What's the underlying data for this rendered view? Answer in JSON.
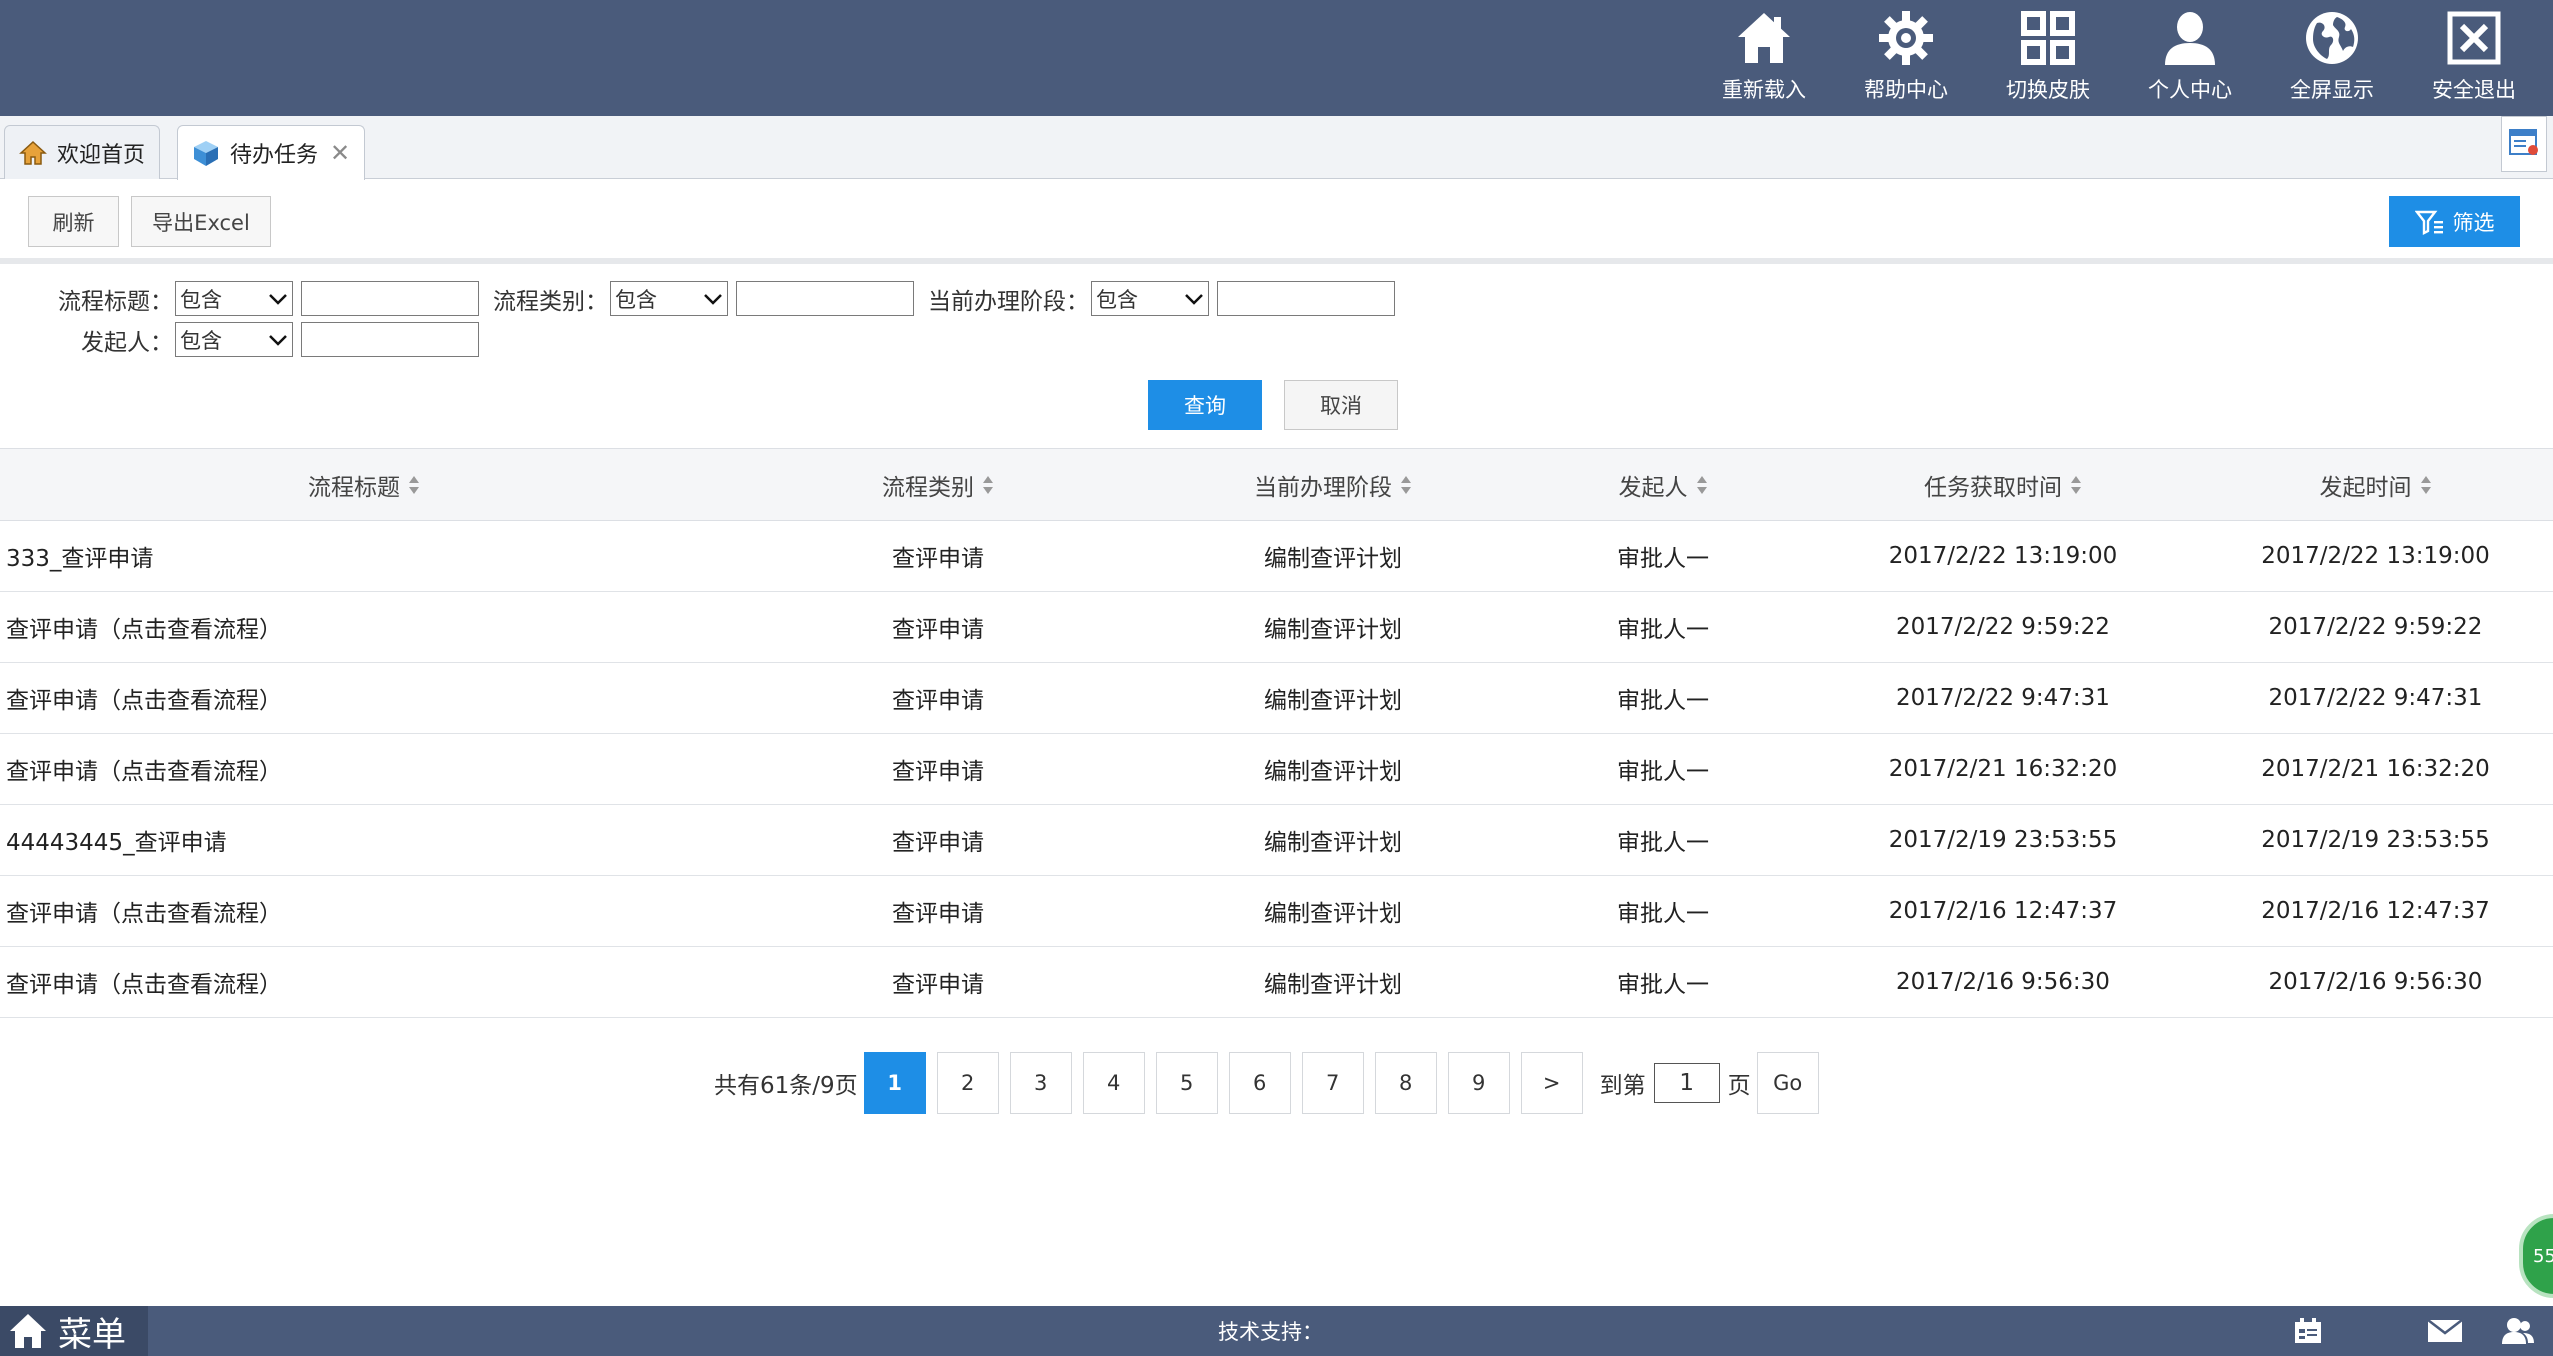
{
  "header": {
    "nav": [
      {
        "label": "重新载入",
        "icon": "home-icon"
      },
      {
        "label": "帮助中心",
        "icon": "gear-icon"
      },
      {
        "label": "切换皮肤",
        "icon": "grid-icon"
      },
      {
        "label": "个人中心",
        "icon": "user-icon"
      },
      {
        "label": "全屏显示",
        "icon": "globe-icon"
      },
      {
        "label": "安全退出",
        "icon": "close-box-icon"
      }
    ]
  },
  "tabs": [
    {
      "label": "欢迎首页",
      "icon": "home-icon"
    },
    {
      "label": "待办任务",
      "icon": "cube-icon",
      "close": "✕"
    }
  ],
  "toolbar": {
    "refresh_label": "刷新",
    "export_label": "导出Excel",
    "filter_label": "筛选"
  },
  "filters": {
    "title_label": "流程标题：",
    "title_op": "包含",
    "type_label": "流程类别：",
    "type_op": "包含",
    "stage_label": "当前办理阶段：",
    "stage_op": "包含",
    "initiator_label": "发起人：",
    "initiator_op": "包含",
    "query_label": "查询",
    "cancel_label": "取消"
  },
  "table": {
    "columns": [
      "流程标题",
      "流程类别",
      "当前办理阶段",
      "发起人",
      "任务获取时间",
      "发起时间"
    ],
    "rows": [
      [
        "333_查评申请",
        "查评申请",
        "编制查评计划",
        "审批人一",
        "2017/2/22 13:19:00",
        "2017/2/22 13:19:00"
      ],
      [
        "查评申请（点击查看流程）",
        "查评申请",
        "编制查评计划",
        "审批人一",
        "2017/2/22 9:59:22",
        "2017/2/22 9:59:22"
      ],
      [
        "查评申请（点击查看流程）",
        "查评申请",
        "编制查评计划",
        "审批人一",
        "2017/2/22 9:47:31",
        "2017/2/22 9:47:31"
      ],
      [
        "查评申请（点击查看流程）",
        "查评申请",
        "编制查评计划",
        "审批人一",
        "2017/2/21 16:32:20",
        "2017/2/21 16:32:20"
      ],
      [
        "44443445_查评申请",
        "查评申请",
        "编制查评计划",
        "审批人一",
        "2017/2/19 23:53:55",
        "2017/2/19 23:53:55"
      ],
      [
        "查评申请（点击查看流程）",
        "查评申请",
        "编制查评计划",
        "审批人一",
        "2017/2/16 12:47:37",
        "2017/2/16 12:47:37"
      ],
      [
        "查评申请（点击查看流程）",
        "查评申请",
        "编制查评计划",
        "审批人一",
        "2017/2/16 9:56:30",
        "2017/2/16 9:56:30"
      ]
    ]
  },
  "pager": {
    "total_text": "共有61条/9页",
    "pages": [
      "1",
      "2",
      "3",
      "4",
      "5",
      "6",
      "7",
      "8",
      "9"
    ],
    "current": "1",
    "next": ">",
    "goto_prefix": "到第",
    "goto_value": "1",
    "goto_suffix": "页",
    "go_label": "Go"
  },
  "bubble": {
    "text": "55"
  },
  "footer": {
    "menu_label": "菜单",
    "tech_support": "技术支持：",
    "icons": [
      "calendar-icon",
      "mail-icon",
      "users-icon"
    ]
  },
  "colors": {
    "header_bg": "#4a5b7b",
    "accent": "#1e8ee6",
    "bubble": "#2fa24a"
  }
}
